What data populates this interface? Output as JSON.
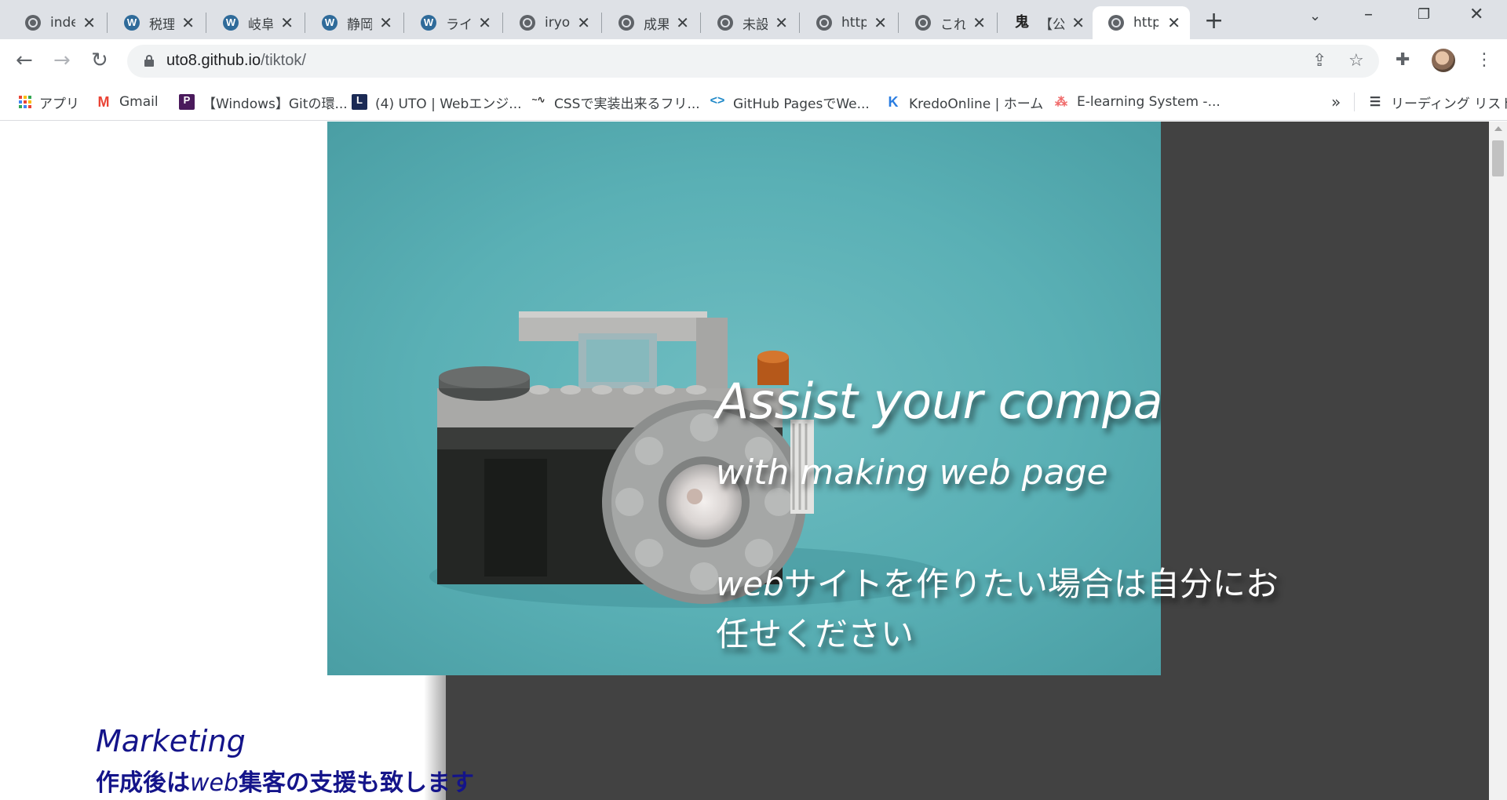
{
  "browser": {
    "tabs": [
      {
        "title": "index",
        "favicon": "globe-icon"
      },
      {
        "title": "税理士",
        "favicon": "wordpress-icon"
      },
      {
        "title": "岐阜",
        "favicon": "wordpress-icon"
      },
      {
        "title": "静岡",
        "favicon": "wordpress-icon"
      },
      {
        "title": "ライフ",
        "favicon": "wordpress-icon"
      },
      {
        "title": "iryo",
        "favicon": "globe-icon"
      },
      {
        "title": "成果",
        "favicon": "globe-icon"
      },
      {
        "title": "未設",
        "favicon": "globe-icon"
      },
      {
        "title": "https",
        "favicon": "globe-icon"
      },
      {
        "title": "これ",
        "favicon": "globe-icon"
      },
      {
        "title": "【公",
        "favicon": "kanji-icon"
      },
      {
        "title": "https",
        "favicon": "globe-icon",
        "active": true
      }
    ],
    "url_host": "uto8.github.io",
    "url_path": "/tiktok/",
    "bookmarks": [
      {
        "label": "アプリ",
        "icon": "apps-grid-icon"
      },
      {
        "label": "Gmail",
        "icon": "gmail-icon"
      },
      {
        "label": "【Windows】Gitの環...",
        "icon": "p-icon"
      },
      {
        "label": "(4) UTO | Webエンジ...",
        "icon": "l-icon"
      },
      {
        "label": "CSSで実装出来るフリ...",
        "icon": "squiggle-icon"
      },
      {
        "label": "GitHub PagesでWe...",
        "icon": "code-icon"
      },
      {
        "label": "KredoOnline | ホーム",
        "icon": "kredo-icon"
      },
      {
        "label": "E-learning System -...",
        "icon": "asana-icon"
      }
    ],
    "overflow_label": "»",
    "reading_list_label": "リーディング リスト"
  },
  "page": {
    "hero_title": "Assist your company",
    "hero_subtitle": "with making web page",
    "hero_jp_em": "web",
    "hero_jp_rest": "サイトを作りたい場合は自分にお任せください",
    "section_title": "Marketing",
    "section_sub_pre": "作成後は",
    "section_sub_em": "web",
    "section_sub_post": "集客の支援も致します"
  },
  "colors": {
    "hero_bg": "#5ab0b5",
    "dark_panel": "#424242",
    "section_text": "#14148a"
  }
}
